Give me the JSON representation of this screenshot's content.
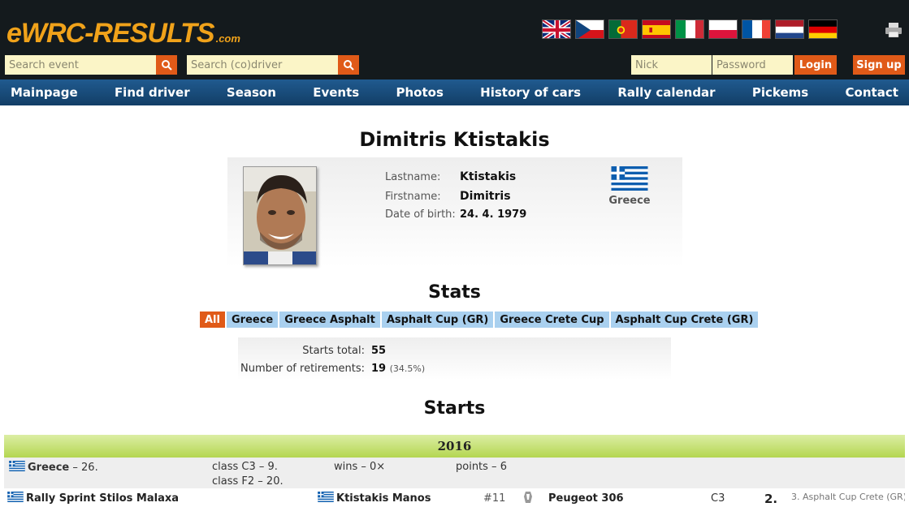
{
  "header": {
    "logo": {
      "main": "eWRC-RESULTS",
      "suffix": ".com"
    },
    "languages": [
      {
        "icon": "flag-uk-icon"
      },
      {
        "icon": "flag-cz-icon"
      },
      {
        "icon": "flag-pt-icon"
      },
      {
        "icon": "flag-es-icon"
      },
      {
        "icon": "flag-it-icon"
      },
      {
        "icon": "flag-pl-icon"
      },
      {
        "icon": "flag-fr-icon"
      },
      {
        "icon": "flag-nl-icon"
      },
      {
        "icon": "flag-de-icon"
      }
    ],
    "search_event_placeholder": "Search event",
    "search_driver_placeholder": "Search (co)driver",
    "nick_placeholder": "Nick",
    "password_placeholder": "Password",
    "login_label": "Login",
    "signup_label": "Sign up",
    "accent_color": "#e05a18"
  },
  "nav": {
    "items": [
      "Mainpage",
      "Find driver",
      "Season",
      "Events",
      "Photos",
      "History of cars",
      "Rally calendar",
      "Pickems",
      "Contact"
    ]
  },
  "profile": {
    "name": "Dimitris Ktistakis",
    "lastname_label": "Lastname:",
    "lastname": "Ktistakis",
    "firstname_label": "Firstname:",
    "firstname": "Dimitris",
    "dob_label": "Date of birth:",
    "dob": "24. 4. 1979",
    "country": "Greece"
  },
  "stats": {
    "heading": "Stats",
    "filters": [
      "All",
      "Greece",
      "Greece Asphalt",
      "Asphalt Cup (GR)",
      "Greece Crete Cup",
      "Asphalt Cup Crete (GR)"
    ],
    "active_filter": "All",
    "starts_total_label": "Starts total:",
    "starts_total": "55",
    "retirements_label": "Number of retirements:",
    "retirements": "19",
    "retirements_pct": "(34.5%)"
  },
  "starts": {
    "heading": "Starts",
    "year": "2016",
    "season_summary": {
      "country": "Greece",
      "position": "– 26.",
      "class_c3": "class C3 – 9.",
      "class_f2": "class F2 – 20.",
      "wins": "wins – 0×",
      "points": "points – 6"
    },
    "events": [
      {
        "event": "Rally Sprint Stilos Malaxa",
        "codriver": "Ktistakis Manos",
        "number": "#11",
        "car": "Peugeot 306",
        "class": "C3",
        "result": "2.",
        "note": "3. Asphalt Cup Crete (GR)"
      }
    ]
  }
}
